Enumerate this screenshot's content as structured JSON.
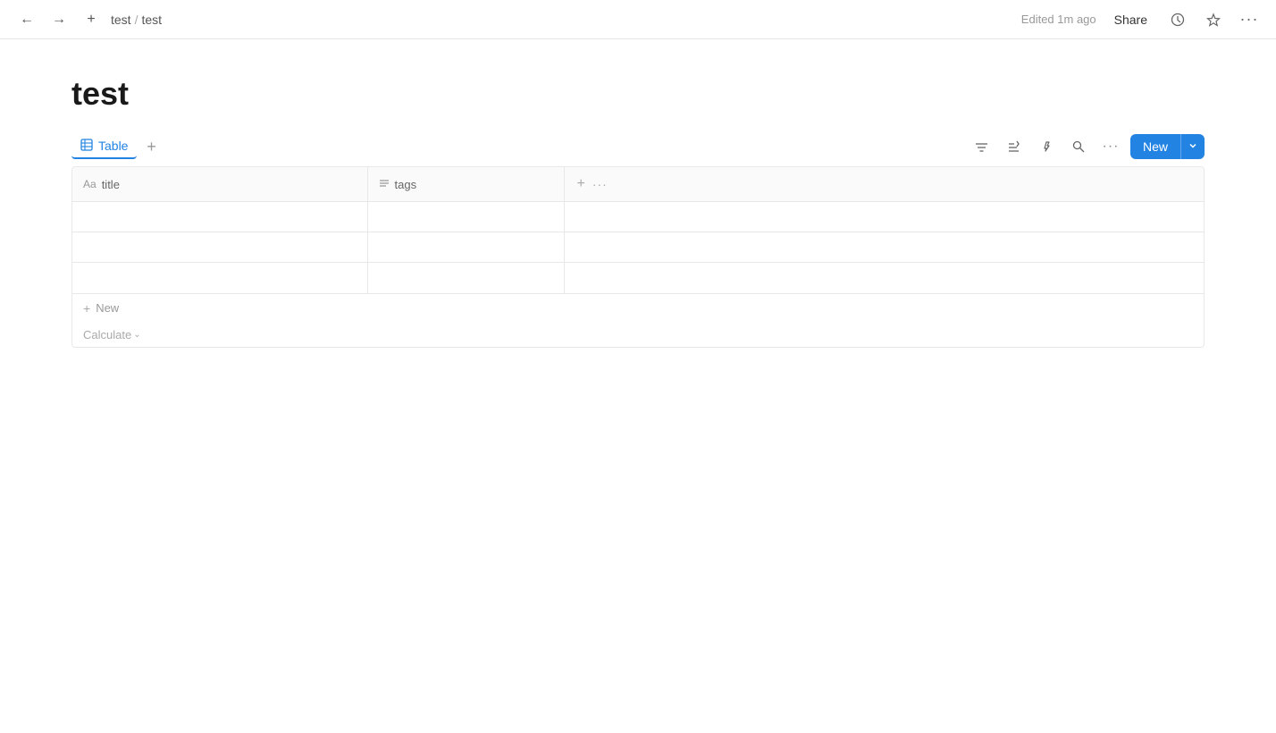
{
  "nav": {
    "back_label": "←",
    "forward_label": "→",
    "new_label": "+",
    "breadcrumb": [
      "test",
      "test"
    ],
    "breadcrumb_sep": "/",
    "edited_text": "Edited 1m ago",
    "share_label": "Share",
    "history_icon": "🕐",
    "star_icon": "☆",
    "more_icon": "···"
  },
  "page": {
    "title": "test"
  },
  "view_bar": {
    "table_icon": "⊞",
    "table_label": "Table",
    "add_view_label": "+",
    "filter_icon": "≡",
    "sort_icon": "↕",
    "automation_icon": "⚡",
    "search_icon": "🔍",
    "more_icon": "···",
    "new_label": "New",
    "dropdown_label": "▾"
  },
  "table": {
    "columns": [
      {
        "id": "title",
        "icon": "Aa",
        "label": "title"
      },
      {
        "id": "tags",
        "icon": "≡",
        "label": "tags"
      }
    ],
    "rows": [
      {
        "title": "",
        "tags": ""
      },
      {
        "title": "",
        "tags": ""
      },
      {
        "title": "",
        "tags": ""
      }
    ],
    "add_row_label": "New",
    "calculate_label": "Calculate",
    "calculate_chevron": "⌄",
    "add_col_icon": "+",
    "add_col_more_icon": "···"
  }
}
